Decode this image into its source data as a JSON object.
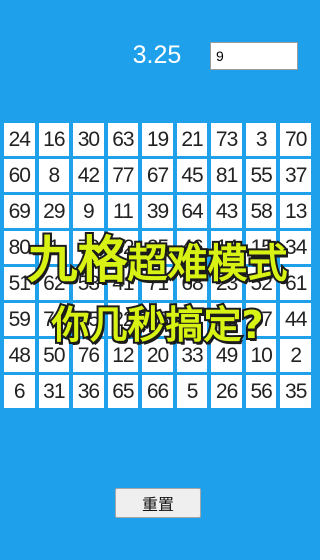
{
  "header": {
    "timer": "3.25",
    "answer_value": "9"
  },
  "grid": [
    [
      "24",
      "16",
      "30",
      "63",
      "19",
      "21",
      "73",
      "3",
      "70"
    ],
    [
      "60",
      "8",
      "42",
      "77",
      "67",
      "45",
      "81",
      "55",
      "37"
    ],
    [
      "69",
      "29",
      "9",
      "11",
      "39",
      "64",
      "43",
      "58",
      "13"
    ],
    [
      "80",
      "1",
      "79",
      "32",
      "25",
      "46",
      "14",
      "15",
      "34"
    ],
    [
      "51",
      "62",
      "53",
      "41",
      "71",
      "68",
      "23",
      "52",
      "61"
    ],
    [
      "59",
      "79",
      "75",
      "22",
      "28",
      "41",
      "18",
      "57",
      "44"
    ],
    [
      "48",
      "50",
      "76",
      "12",
      "20",
      "33",
      "49",
      "10",
      "2"
    ],
    [
      "6",
      "31",
      "36",
      "65",
      "66",
      "5",
      "26",
      "56",
      "35"
    ]
  ],
  "banner": {
    "line1_big": "九格",
    "line1_rest": "超难模式",
    "line2": "你几秒搞定?"
  },
  "reset_label": "重置",
  "colors": {
    "background": "#1ea0ea",
    "banner_text": "#d8f214",
    "cell": "#ffffff"
  }
}
